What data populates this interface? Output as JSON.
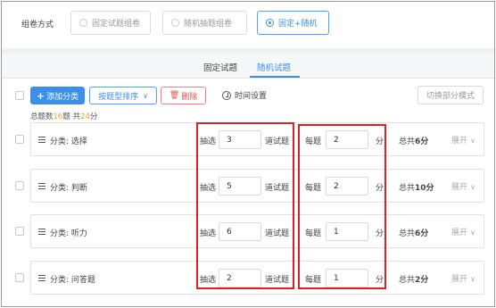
{
  "mode": {
    "label": "组卷方式",
    "options": [
      {
        "label": "固定试题组卷",
        "selected": false
      },
      {
        "label": "随机抽题组卷",
        "selected": false
      },
      {
        "label": "固定+随机",
        "selected": true
      }
    ]
  },
  "tabs": [
    {
      "label": "固定试题",
      "active": false
    },
    {
      "label": "随机试题",
      "active": true
    }
  ],
  "toolbar": {
    "add_category": "添加分类",
    "sort_by": "按题型排序",
    "delete": "删除",
    "time_setting": "时间设置",
    "switch_mode": "切换部分模式"
  },
  "summary": {
    "prefix": "总题数",
    "count": "16",
    "mid": "题 共",
    "score": "24",
    "suffix": "分"
  },
  "rows": [
    {
      "category": "分类: 选择",
      "draw_label": "抽选",
      "draw_count": "3",
      "draw_unit": "道试题",
      "per_label": "每题",
      "per_score": "2",
      "per_unit": "分",
      "total_prefix": "总共",
      "total": "6分",
      "expand": "展开"
    },
    {
      "category": "分类: 判断",
      "draw_label": "抽选",
      "draw_count": "5",
      "draw_unit": "道试题",
      "per_label": "每题",
      "per_score": "2",
      "per_unit": "分",
      "total_prefix": "总共",
      "total": "10分",
      "expand": "展开"
    },
    {
      "category": "分类: 听力",
      "draw_label": "抽选",
      "draw_count": "6",
      "draw_unit": "道试题",
      "per_label": "每题",
      "per_score": "1",
      "per_unit": "分",
      "total_prefix": "总共",
      "total": "6分",
      "expand": "展开"
    },
    {
      "category": "分类: 问答题",
      "draw_label": "抽选",
      "draw_count": "2",
      "draw_unit": "道试题",
      "per_label": "每题",
      "per_score": "1",
      "per_unit": "分",
      "total_prefix": "总共",
      "total": "2分",
      "expand": "展开"
    }
  ],
  "colors": {
    "accent": "#3b8fe8",
    "danger": "#e05252",
    "highlight": "#e02020",
    "summary_number": "#f0a020"
  }
}
